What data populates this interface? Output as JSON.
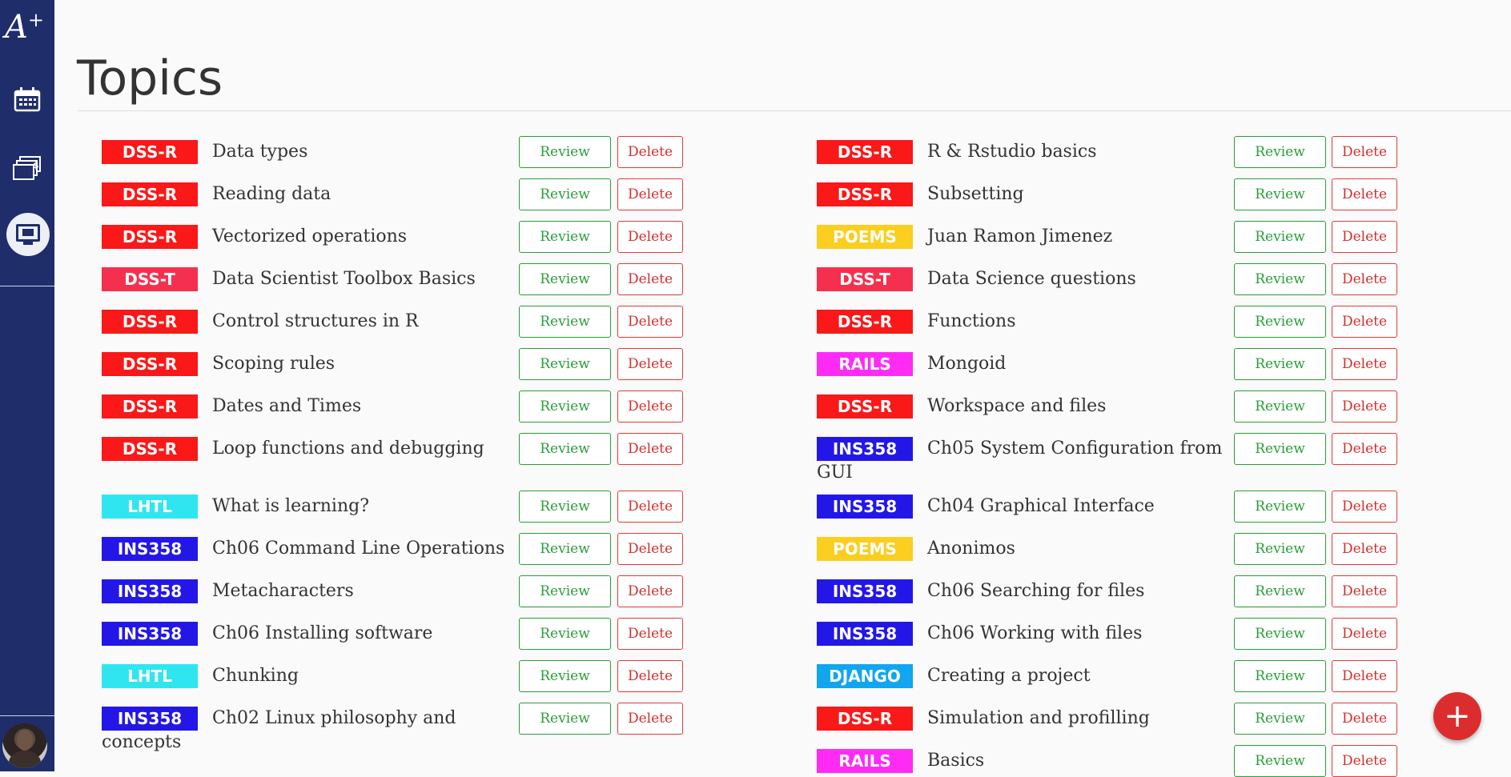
{
  "sidebar": {
    "logo": "A",
    "logo_plus": "+",
    "nav_icons": [
      "calendar-icon",
      "cards-icon",
      "topics-icon"
    ]
  },
  "page": {
    "title": "Topics"
  },
  "colors": {
    "DSS-R": "#fa1818",
    "DSS-T": "#f5304e",
    "POEMS": "#fbce1f",
    "RAILS": "#ff2bf5",
    "LHTL": "#2fe6f0",
    "INS358": "#2317e8",
    "DJANGO": "#10a6f0",
    "review": "#2a9d3a",
    "delete": "#d42d2d",
    "sidebar": "#1f2d6b"
  },
  "actions": {
    "review_label": "Review",
    "delete_label": "Delete"
  },
  "topics_left": [
    {
      "tag": "DSS-R",
      "name": "Data types"
    },
    {
      "tag": "DSS-R",
      "name": "Reading data"
    },
    {
      "tag": "DSS-R",
      "name": "Vectorized operations"
    },
    {
      "tag": "DSS-T",
      "name": "Data Scientist Toolbox Basics"
    },
    {
      "tag": "DSS-R",
      "name": "Control structures in R"
    },
    {
      "tag": "DSS-R",
      "name": "Scoping rules"
    },
    {
      "tag": "DSS-R",
      "name": "Dates and Times"
    },
    {
      "tag": "DSS-R",
      "name": "Loop functions and debugging"
    },
    {
      "tag": "LHTL",
      "name": "What is learning?"
    },
    {
      "tag": "INS358",
      "name": "Ch06 Command Line Operations"
    },
    {
      "tag": "INS358",
      "name": "Metacharacters"
    },
    {
      "tag": "INS358",
      "name": "Ch06 Installing software"
    },
    {
      "tag": "LHTL",
      "name": "Chunking"
    },
    {
      "tag": "INS358",
      "name": "Ch02 Linux philosophy and concepts"
    }
  ],
  "topics_right": [
    {
      "tag": "DSS-R",
      "name": "R & Rstudio basics"
    },
    {
      "tag": "DSS-R",
      "name": "Subsetting"
    },
    {
      "tag": "POEMS",
      "name": "Juan Ramon Jimenez"
    },
    {
      "tag": "DSS-T",
      "name": "Data Science questions"
    },
    {
      "tag": "DSS-R",
      "name": "Functions"
    },
    {
      "tag": "RAILS",
      "name": "Mongoid"
    },
    {
      "tag": "DSS-R",
      "name": "Workspace and files"
    },
    {
      "tag": "INS358",
      "name": "Ch05 System Configuration from GUI"
    },
    {
      "tag": "INS358",
      "name": "Ch04 Graphical Interface"
    },
    {
      "tag": "POEMS",
      "name": "Anonimos"
    },
    {
      "tag": "INS358",
      "name": "Ch06 Searching for files"
    },
    {
      "tag": "INS358",
      "name": "Ch06 Working with files"
    },
    {
      "tag": "DJANGO",
      "name": "Creating a project"
    },
    {
      "tag": "DSS-R",
      "name": "Simulation and profilling"
    },
    {
      "tag": "RAILS",
      "name": "Basics"
    }
  ],
  "fab": {
    "label": "+"
  }
}
